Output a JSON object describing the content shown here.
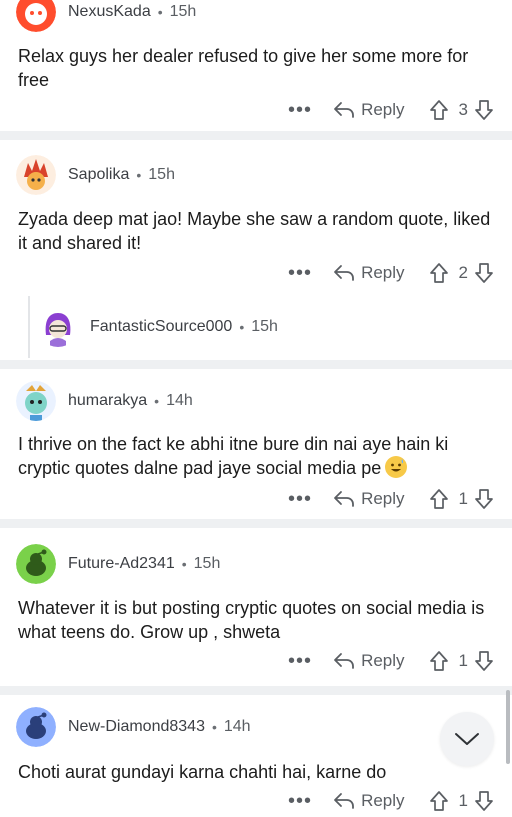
{
  "comments": [
    {
      "username": "NexusKada",
      "time": "15h",
      "text": "Relax guys her dealer refused to give her some more for free",
      "reply_label": "Reply",
      "votes": "3",
      "more": "•••"
    },
    {
      "username": "Sapolika",
      "time": "15h",
      "text": "Zyada deep mat jao! Maybe she saw a random quote, liked it and shared it!",
      "reply_label": "Reply",
      "votes": "2",
      "more": "•••"
    },
    {
      "username": "FantasticSource000",
      "time": "15h"
    },
    {
      "username": "humarakya",
      "time": "14h",
      "text": "I thrive on the fact ke abhi itne bure din nai aye hain ki cryptic quotes dalne pad jaye social media pe",
      "reply_label": "Reply",
      "votes": "1",
      "more": "•••"
    },
    {
      "username": "Future-Ad2341",
      "time": "15h",
      "text": "Whatever it is but posting cryptic quotes on social media is what teens do. Grow up , shweta",
      "reply_label": "Reply",
      "votes": "1",
      "more": "•••"
    },
    {
      "username": "New-Diamond8343",
      "time": "14h",
      "text": "Choti aurat gundayi karna chahti hai, karne do",
      "reply_label": "Reply",
      "votes": "1",
      "more": "•••"
    }
  ],
  "separator": "•",
  "icons": {
    "reply": "reply-arrow-icon",
    "upvote": "upvote-icon",
    "downvote": "downvote-icon",
    "scroll_down": "chevron-down-icon"
  },
  "colors": {
    "text": "#1c1c1c",
    "muted": "#5a5e63",
    "divider": "#eef0f2",
    "avatar_green": "#7ad14a",
    "avatar_blue": "#8fb0ff"
  }
}
